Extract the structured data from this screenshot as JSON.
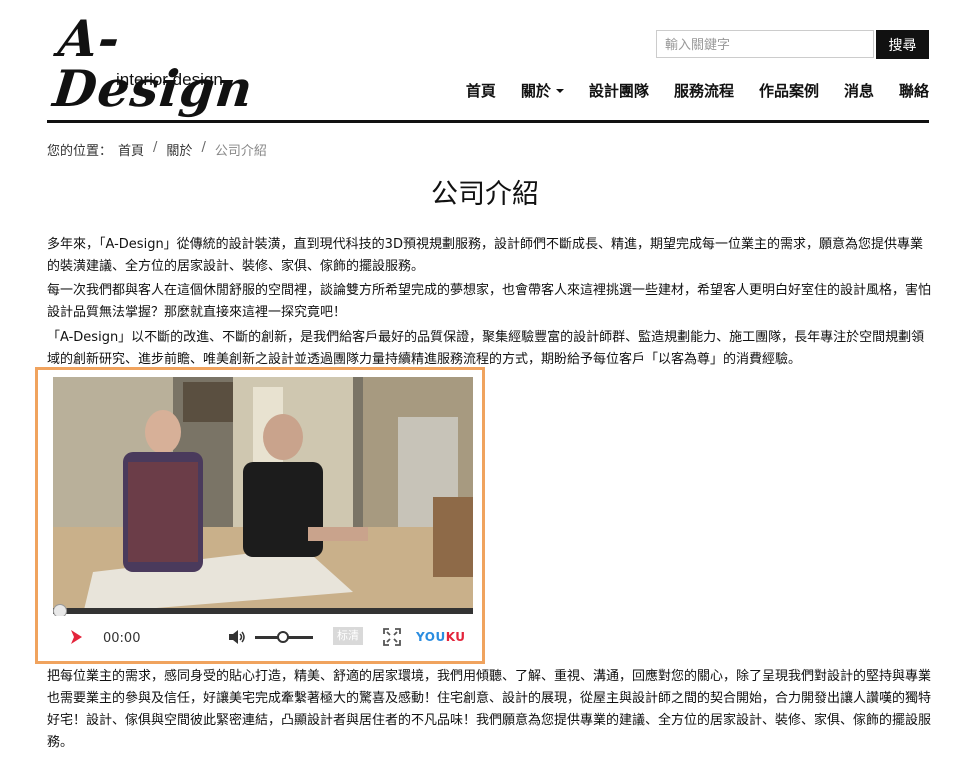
{
  "logo": {
    "title": "A-Design",
    "subtitle": "interior design"
  },
  "search": {
    "placeholder": "輸入關鍵字",
    "button_label": "搜尋"
  },
  "nav": {
    "items": [
      {
        "label": "首頁",
        "has_dropdown": false
      },
      {
        "label": "關於",
        "has_dropdown": true
      },
      {
        "label": "設計團隊",
        "has_dropdown": false
      },
      {
        "label": "服務流程",
        "has_dropdown": false
      },
      {
        "label": "作品案例",
        "has_dropdown": false
      },
      {
        "label": "消息",
        "has_dropdown": false
      },
      {
        "label": "聯絡",
        "has_dropdown": false
      }
    ]
  },
  "breadcrumb": {
    "prefix": "您的位置：",
    "items": [
      "首頁",
      "關於",
      "公司介紹"
    ],
    "separator": "/"
  },
  "page_title": "公司介紹",
  "paragraphs": [
    "多年來，「A-Design」從傳統的設計裝潢，直到現代科技的3D預視規劃服務，設計師們不斷成長、精進，期望完成每一位業主的需求，願意為您提供專業的裝潢建議、全方位的居家設計、裝修、家俱、傢飾的擺設服務。",
    "每一次我們都與客人在這個休閒舒服的空間裡，談論雙方所希望完成的夢想家，也會帶客人來這裡挑選一些建材，希望客人更明白好室住的設計風格，害怕設計品質無法掌握？那麼就直接來這裡一探究竟吧！",
    "「A-Design」以不斷的改進、不斷的創新，是我們給客戶最好的品質保證，聚集經驗豐富的設計師群、監造規劃能力、施工團隊，長年專注於空間規劃領域的創新研究、進步前瞻、唯美創新之設計並透過團隊力量持續精進服務流程的方式，期盼給予每位客戶「以客為尊」的消費經驗。",
    "把每位業主的需求，感同身受的貼心打造，精美、舒適的居家環境，我們用傾聽、了解、重視、溝通，回應對您的關心，除了呈現我們對設計的堅持與專業也需要業主的參與及信任，好讓美宅完成牽繫著極大的驚喜及感動！住宅創意、設計的展現，從屋主與設計師之間的契合開始，合力開發出讓人讚嘆的獨特好宅！設計、傢俱與空間彼此緊密連結，凸顯設計者與居住者的不凡品味！我們願意為您提供專業的建議、全方位的居家設計、裝修、家俱、傢飾的擺設服務。"
  ],
  "video": {
    "time": "00:00",
    "quality_label": "标清",
    "brand_you": "YOU",
    "brand_ku": "KU",
    "progress": 0,
    "volume": 0.5
  },
  "colors": {
    "accent_border": "#f0a35e",
    "text": "#111111",
    "youku_blue": "#2b8de0",
    "youku_red": "#e3243b"
  }
}
